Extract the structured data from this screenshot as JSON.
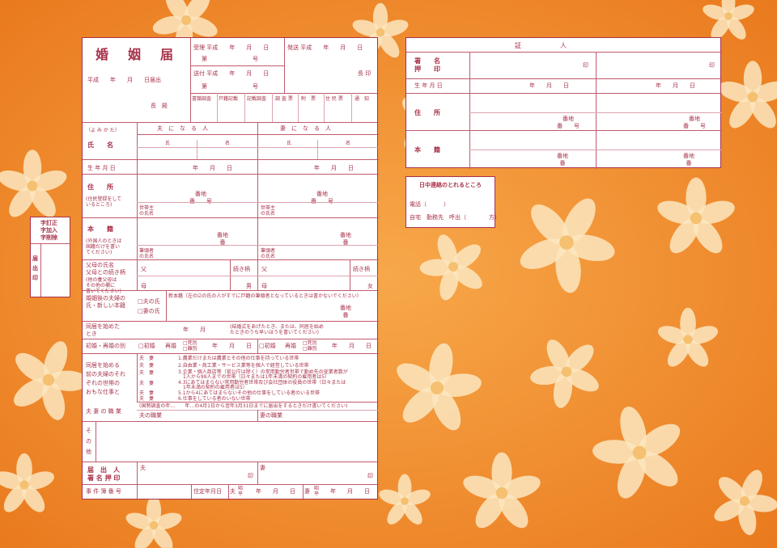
{
  "colors": {
    "background": "#f08a2a",
    "ink": "#a8324a",
    "paper": "#ffffff",
    "flower": "#fbe6c0"
  },
  "main": {
    "title": "婚　姻　届",
    "date_line": "平成　　年　　月　　日届出",
    "chief": "長　殿",
    "receipt": "受理 平成　　年　　月　　日",
    "receipt_no": "第　　　　　　　　号",
    "sent": "送付 平成　　年　　月　　日",
    "sent_no": "第　　　　　　　　号",
    "dispatch": "発送 平成　　年　　月　　日",
    "mayor_seal": "長 印",
    "office_cols": [
      "書類調査",
      "戸籍記載",
      "記載調査",
      "調 査 票",
      "附　票",
      "住 民 票",
      "通　知"
    ],
    "yomikata": "（よ み か た）",
    "husband_header": "夫　に　な　る　人",
    "wife_header": "妻　に　な　る　人",
    "name_label": "氏　　名",
    "surname": "氏",
    "given": "名",
    "dob_label": "生 年 月 日",
    "ymd": "年　　月　　日",
    "address_label": "住　　所",
    "address_note": "(住民登録をして\nいるところ)",
    "banchi": "番地\n番　　号",
    "householder": "世帯主\nの氏名",
    "honseki_label": "本　　籍",
    "honseki_note": "(外国人のときは\n国籍だけを書い\nてください)",
    "banchi2": "番地\n番",
    "head_name": "筆頭者\nの氏名",
    "parents_label": "父母の氏名\n父母との続き柄",
    "parents_note": "(他の養父母は\nその他の欄に\n書いてください)",
    "father": "父",
    "mother": "母",
    "relation": "続き柄",
    "son": "男",
    "daughter": "女",
    "surname_after_label": "婚姻後の夫婦の\n氏・新しい本籍",
    "husband_surname_opt": "□夫の氏",
    "wife_surname_opt": "□妻の氏",
    "new_honseki": "新本籍（左の☑の氏の人がすでに戸籍の筆頭者となっているときは書かないでください）",
    "cohab_label": "同居を始めた\nとき",
    "cohab_date": "年　　月",
    "cohab_note": "(結婚式をあげたとき、または、同居を始め\nたときのうち早いほうを書いてください)",
    "remarriage_label": "初婚・再婚の別",
    "first": "□初婚",
    "re": "再婚",
    "death": "□死別",
    "divorce": "□離別",
    "work_label": "同居を始める\n前の夫婦のそれ\nぞれの世帯の\nおもな仕事と",
    "work_items": [
      "1.農業だけまたは農業とその他の仕事を持っている世帯",
      "2.自由業・商工業・サービス業等を個人で経営している世帯",
      "3.企業・個人商店等（官公庁は除く）の常用勤労者世帯で勤め先の従業者数が",
      "　1人から99人までの世帯（日々または1年未満の契約の雇用者は5）",
      "4.3にあてはまらない常用勤労者世帯及び会社団体の役員の世帯（日々または",
      "　1年未満の契約の雇用者は5）",
      "5.1から4にあてはまらないその他の仕事をしている者のいる世帯",
      "6.仕事をしている者のいない世帯"
    ],
    "fuma": "夫　妻",
    "job_label": "夫 妻 の 職 業",
    "census_note": "(国勢調査の年…　　年…の4月1日から翌年3月31日までに届出をするときだけ書いてください)",
    "husband_job": "夫の職業",
    "wife_job": "妻の職業",
    "other_label": "そ\nの\n他",
    "applicant_label": "届　出　人\n署 名 押 印",
    "husband": "夫",
    "wife": "妻",
    "seal": "印",
    "case_no": "事 件 簿 番 号",
    "residence_fixed": "住定年月日",
    "meiji_label": "昭\n平",
    "husband_short": "夫",
    "wife_short": "妻"
  },
  "side": {
    "correction": "字訂正\n字加入\n字削除",
    "seal_label": "届\n出\n印"
  },
  "witness": {
    "header": "証　　　　　　人",
    "sign_label": "署　　名\n押　　印",
    "seal": "印",
    "dob_label": "生 年 月 日",
    "ymd": "年　　月　　日",
    "address_label": "住　　所",
    "banchi": "番地\n番　　号",
    "honseki_label": "本　　籍",
    "banchi2": "番地\n番"
  },
  "contact": {
    "title": "日中連絡のとれるところ",
    "phone": "電話（　　　）",
    "options": "自宅　勤務先　呼出（　　　　方）"
  }
}
